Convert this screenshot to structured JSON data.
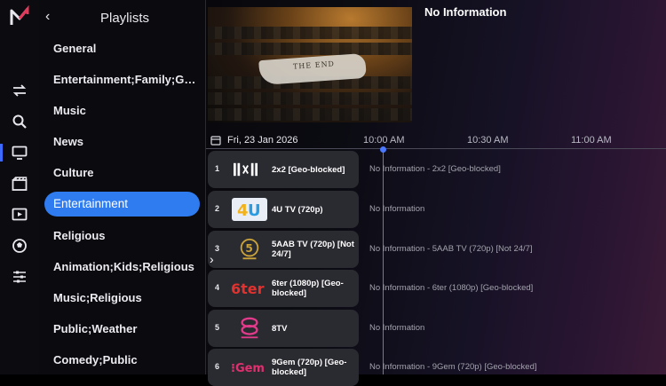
{
  "rail": {
    "icons": [
      "app-logo",
      "switch-icon",
      "search-icon",
      "tv-icon",
      "movie-icon",
      "play-icon",
      "sports-icon",
      "settings-icon"
    ]
  },
  "playlists": {
    "title": "Playlists",
    "back": "‹",
    "items": [
      {
        "label": "General"
      },
      {
        "label": "Entertainment;Family;Gene.."
      },
      {
        "label": "Music"
      },
      {
        "label": "News"
      },
      {
        "label": "Culture"
      },
      {
        "label": "Entertainment",
        "active": true
      },
      {
        "label": "Religious"
      },
      {
        "label": "Animation;Kids;Religious"
      },
      {
        "label": "Music;Religious"
      },
      {
        "label": "Public;Weather"
      },
      {
        "label": "Comedy;Public"
      }
    ]
  },
  "preview": {
    "title": "No Information",
    "frame_text": "THE END"
  },
  "guide": {
    "date": "Fri, 23 Jan 2026",
    "times": [
      "10:00 AM",
      "10:30 AM",
      "11:00 AM"
    ],
    "expand": "›",
    "channels": [
      {
        "num": "1",
        "name": "2x2 [Geo-blocked]",
        "logo": "2x2-logo",
        "program": "No Information - 2x2 [Geo-blocked]"
      },
      {
        "num": "2",
        "name": "4U TV (720p)",
        "logo": "4u-logo",
        "program": "No Information"
      },
      {
        "num": "3",
        "name": "5AAB TV (720p) [Not 24/7]",
        "logo": "5aab-logo",
        "program": "No Information - 5AAB TV (720p) [Not 24/7]"
      },
      {
        "num": "4",
        "name": "6ter (1080p) [Geo-blocked]",
        "logo": "6ter-logo",
        "program": "No Information - 6ter (1080p) [Geo-blocked]"
      },
      {
        "num": "5",
        "name": "8TV",
        "logo": "8tv-logo",
        "program": "No Information"
      },
      {
        "num": "6",
        "name": "9Gem (720p) [Geo-blocked]",
        "logo": "9gem-logo",
        "program": "No Information - 9Gem (720p) [Geo-blocked]"
      }
    ]
  },
  "colors": {
    "accent": "#2f7bf0",
    "now_line": "#4a78ff",
    "card": "#2a2a31"
  }
}
